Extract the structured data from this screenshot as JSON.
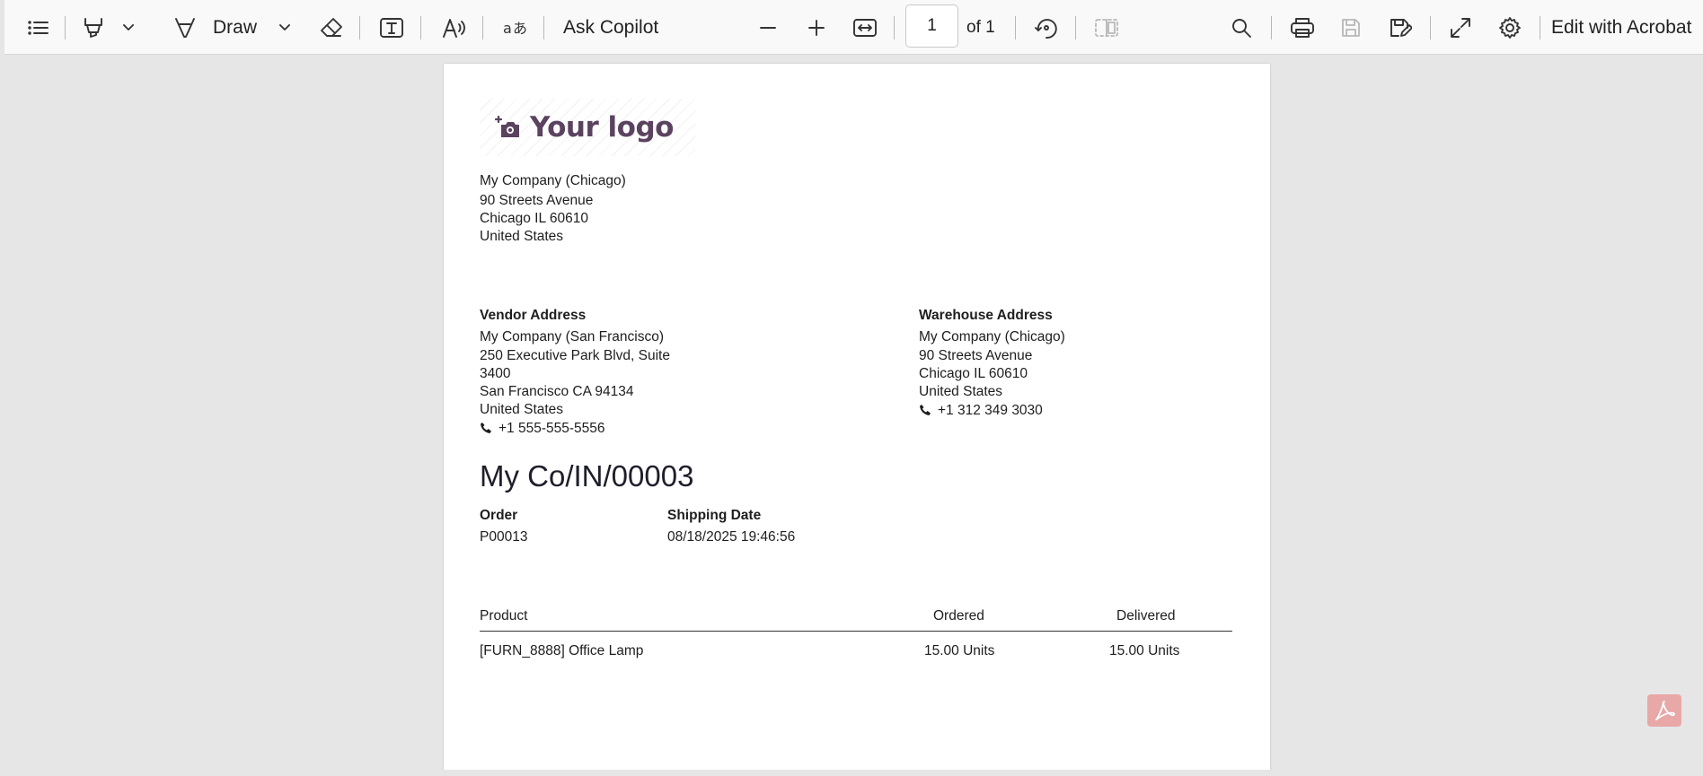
{
  "toolbar": {
    "draw_label": "Draw",
    "ask_copilot_label": "Ask Copilot",
    "page_number": "1",
    "page_total": "of 1",
    "edit_with_acrobat_label": "Edit with Acrobat",
    "icons": [
      "contents-icon",
      "highlight-icon",
      "chevron-down-icon",
      "draw-icon",
      "eraser-icon",
      "text-box-icon",
      "read-aloud-icon",
      "translate-icon",
      "zoom-out-icon",
      "zoom-in-icon",
      "fit-width-icon",
      "rotate-icon",
      "two-page-icon",
      "search-icon",
      "print-icon",
      "save-icon",
      "save-as-icon",
      "fullscreen-icon",
      "settings-icon"
    ]
  },
  "document": {
    "logo_text": "Your logo",
    "company": {
      "name": "My Company (Chicago)",
      "street": "90 Streets Avenue",
      "city": "Chicago IL 60610",
      "country": "United States"
    },
    "vendor": {
      "heading": "Vendor Address",
      "name": "My Company (San Francisco)",
      "street_1": "250 Executive Park Blvd, Suite",
      "street_2": "3400",
      "city": "San Francisco CA 94134",
      "country": "United States",
      "phone": "+1 555-555-5556"
    },
    "warehouse": {
      "heading": "Warehouse Address",
      "name": "My Company (Chicago)",
      "street": "90 Streets Avenue",
      "city": "Chicago IL 60610",
      "country": "United States",
      "phone": "+1 312 349 3030"
    },
    "title": "My Co/IN/00003",
    "order_label": "Order",
    "order_value": "P00013",
    "shipping_date_label": "Shipping Date",
    "shipping_date_value": "08/18/2025 19:46:56",
    "table": {
      "headers": {
        "product": "Product",
        "ordered": "Ordered",
        "delivered": "Delivered"
      },
      "rows": [
        {
          "product": "[FURN_8888] Office Lamp",
          "ordered": "15.00 Units",
          "delivered": "15.00 Units"
        }
      ]
    }
  },
  "colors": {
    "logo": "#5b4360",
    "toolbar_bg": "#f9f9f9",
    "viewport_bg": "#e6e6e6",
    "acrobat_badge": "#e8a8a8"
  }
}
